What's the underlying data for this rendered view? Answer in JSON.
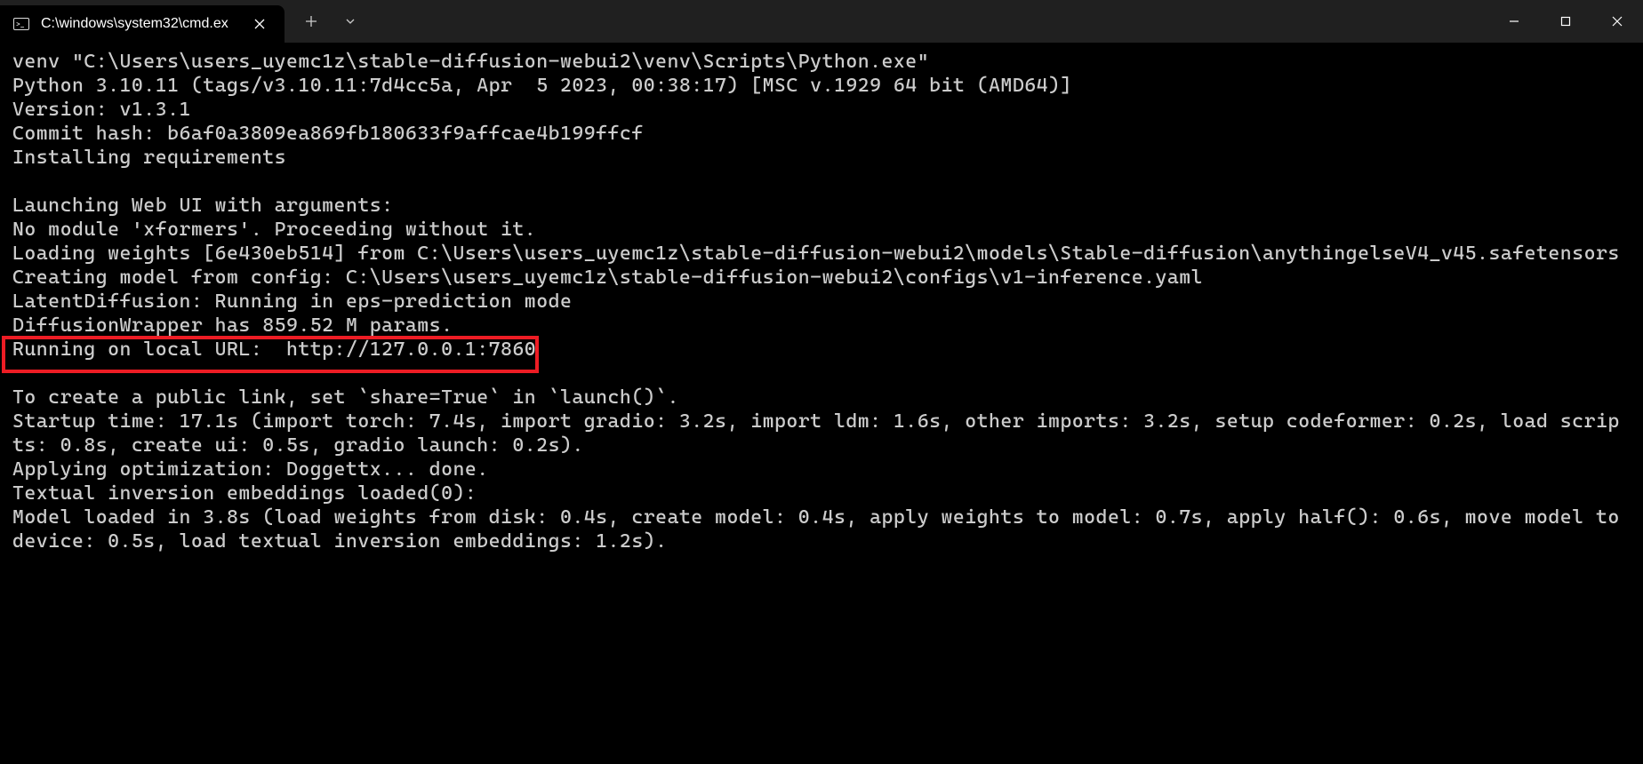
{
  "window": {
    "tab_title": "C:\\windows\\system32\\cmd.ex"
  },
  "terminal_lines": [
    "venv \"C:\\Users\\users_uyemc1z\\stable-diffusion-webui2\\venv\\Scripts\\Python.exe\"",
    "Python 3.10.11 (tags/v3.10.11:7d4cc5a, Apr  5 2023, 00:38:17) [MSC v.1929 64 bit (AMD64)]",
    "Version: v1.3.1",
    "Commit hash: b6af0a3809ea869fb180633f9affcae4b199ffcf",
    "Installing requirements",
    "",
    "Launching Web UI with arguments:",
    "No module 'xformers'. Proceeding without it.",
    "Loading weights [6e430eb514] from C:\\Users\\users_uyemc1z\\stable-diffusion-webui2\\models\\Stable-diffusion\\anythingelseV4_v45.safetensors",
    "Creating model from config: C:\\Users\\users_uyemc1z\\stable-diffusion-webui2\\configs\\v1-inference.yaml",
    "LatentDiffusion: Running in eps-prediction mode",
    "DiffusionWrapper has 859.52 M params."
  ],
  "highlighted_line": "Running on local URL:  http://127.0.0.1:7860",
  "terminal_lines_after": [
    "",
    "To create a public link, set `share=True` in `launch()`.",
    "Startup time: 17.1s (import torch: 7.4s, import gradio: 3.2s, import ldm: 1.6s, other imports: 3.2s, setup codeformer: 0.2s, load scripts: 0.8s, create ui: 0.5s, gradio launch: 0.2s).",
    "Applying optimization: Doggettx... done.",
    "Textual inversion embeddings loaded(0):",
    "Model loaded in 3.8s (load weights from disk: 0.4s, create model: 0.4s, apply weights to model: 0.7s, apply half(): 0.6s, move model to device: 0.5s, load textual inversion embeddings: 1.2s).",
    ""
  ]
}
